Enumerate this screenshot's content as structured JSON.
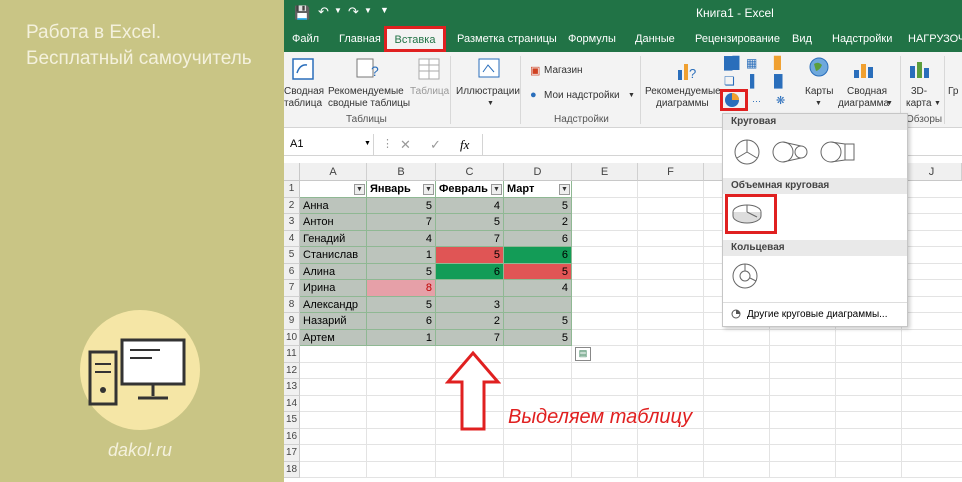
{
  "left_panel": {
    "title_line1": "Работа в Excel.",
    "title_line2": "Бесплатный самоучитель",
    "site": "dakol.ru"
  },
  "titlebar": {
    "title": "Книга1 - Excel"
  },
  "tabs": [
    "Файл",
    "Главная",
    "Вставка",
    "Разметка страницы",
    "Формулы",
    "Данные",
    "Рецензирование",
    "Вид",
    "Надстройки",
    "НАГРУЗОЧ"
  ],
  "ribbon": {
    "pivot_line1": "Сводная",
    "pivot_line2": "таблица",
    "recommended_pivot_line1": "Рекомендуемые",
    "recommended_pivot_line2": "сводные таблицы",
    "table": "Таблица",
    "group_tables": "Таблицы",
    "illustrations": "Иллюстрации",
    "store": "Магазин",
    "my_addins": "Мои надстройки",
    "group_addins": "Надстройки",
    "recommended_charts_line1": "Рекомендуемые",
    "recommended_charts_line2": "диаграммы",
    "maps": "Карты",
    "pivot_chart_line1": "Сводная",
    "pivot_chart_line2": "диаграмма",
    "map3d_line1": "3D-",
    "map3d_line2": "карта",
    "group_tours": "Обзоры",
    "gr": "Гр"
  },
  "formula_bar": {
    "name_box": "A1",
    "fx": "fx"
  },
  "columns": [
    "A",
    "B",
    "C",
    "D",
    "E",
    "F",
    "G",
    "H",
    "I",
    "J"
  ],
  "rows": [
    "1",
    "2",
    "3",
    "4",
    "5",
    "6",
    "7",
    "8",
    "9",
    "10",
    "11",
    "12",
    "13",
    "14",
    "15",
    "16",
    "17",
    "18"
  ],
  "table": {
    "headers": [
      "",
      "Январь",
      "Февраль",
      "Март"
    ],
    "data": [
      [
        "Анна",
        "5",
        "4",
        "5"
      ],
      [
        "Антон",
        "7",
        "5",
        "2"
      ],
      [
        "Генадий",
        "4",
        "7",
        "6"
      ],
      [
        "Станислав",
        "1",
        "5",
        "6"
      ],
      [
        "Алина",
        "5",
        "6",
        "5"
      ],
      [
        "Ирина",
        "8",
        "",
        "4"
      ],
      [
        "Александр",
        "5",
        "3",
        ""
      ],
      [
        "Назарий",
        "6",
        "2",
        "5"
      ],
      [
        "Артем",
        "1",
        "7",
        "5"
      ]
    ]
  },
  "dropdown": {
    "section_pie": "Круговая",
    "section_3d_pie": "Объемная круговая",
    "section_donut": "Кольцевая",
    "more": "Другие круговые диаграммы..."
  },
  "annotation": {
    "caption": "Выделяем таблицу"
  },
  "colors": {
    "excel_green": "#217346",
    "highlight_red": "#e02020",
    "cell_red": "#e05555",
    "cell_green": "#139c57",
    "cell_pink": "#e6a0a8"
  }
}
